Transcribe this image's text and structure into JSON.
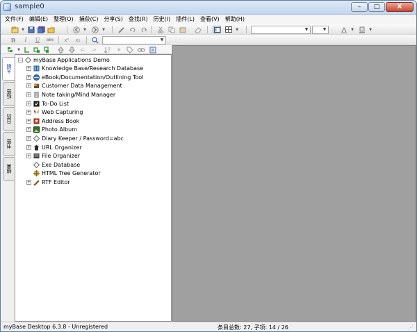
{
  "window": {
    "title": "sample0",
    "controls": {
      "minimize": "–",
      "maximize": "□",
      "close": "X"
    }
  },
  "menubar": {
    "items": [
      "文件(F)",
      "编辑(E)",
      "整理(O)",
      "捕获(C)",
      "分享(S)",
      "查找(R)",
      "历史(I)",
      "插件(L)",
      "查看(V)",
      "帮助(H)"
    ]
  },
  "toolbar": {
    "bold_label": "B",
    "italic_label": "I",
    "underline_label": "U",
    "strike_label": "abc",
    "superscript_label": "x²",
    "subscript_label": "x₂"
  },
  "sidebar": {
    "tabs": [
      "大纲",
      "标签",
      "日历",
      "书签",
      "结果"
    ]
  },
  "tree": {
    "root": "myBase Applications Demo",
    "items": [
      {
        "label": "Knowledge Base/Research Database",
        "icon": "book-icon",
        "expander": "+"
      },
      {
        "label": "eBook/Documentation/Outlining Tool",
        "icon": "globe-icon",
        "expander": "+"
      },
      {
        "label": "Customer Data Management",
        "icon": "users-icon",
        "expander": "+"
      },
      {
        "label": "Note taking/Mind Manager",
        "icon": "note-icon",
        "expander": "+"
      },
      {
        "label": "To-Do List",
        "icon": "checklist-icon",
        "expander": "+"
      },
      {
        "label": "Web Capturing",
        "icon": "butterfly-icon",
        "expander": "+"
      },
      {
        "label": "Address Book",
        "icon": "address-book-icon",
        "expander": "+"
      },
      {
        "label": "Photo Album",
        "icon": "photo-icon",
        "expander": "+"
      },
      {
        "label": "Diary Keeper / Password=abc",
        "icon": "diamond-icon",
        "expander": "+"
      },
      {
        "label": "URL Organizer",
        "icon": "house-icon",
        "expander": "+"
      },
      {
        "label": "File Organizer",
        "icon": "folder-icon",
        "expander": "+"
      },
      {
        "label": "Exe Database",
        "icon": "diamond-icon",
        "expander": ""
      },
      {
        "label": "HTML Tree Generator",
        "icon": "plugin-icon",
        "expander": ""
      },
      {
        "label": "RTF Editor",
        "icon": "pencil-icon",
        "expander": "+"
      }
    ]
  },
  "statusbar": {
    "left": "myBase Desktop 6.3.8 - Unregistered",
    "middle": "条目总数: 27, 子项: 14 / 26"
  },
  "colors": {
    "titlebar": "#c2d6ee",
    "content_bg": "#a0a0a0",
    "active_tab_text": "#1a3fc0"
  }
}
